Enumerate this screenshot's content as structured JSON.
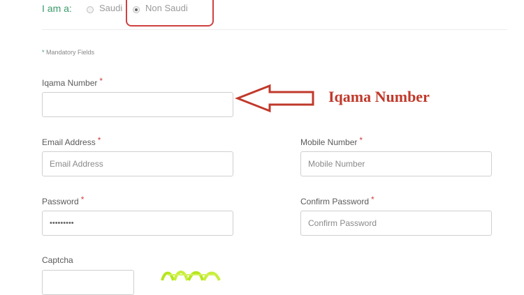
{
  "user_type": {
    "label": "I am a:",
    "options": [
      {
        "label": "Saudi",
        "selected": false
      },
      {
        "label": "Non Saudi",
        "selected": true
      }
    ]
  },
  "form": {
    "mandatory_note": "Mandatory Fields",
    "mandatory_marker": "*",
    "required_marker": "*",
    "iqama": {
      "label": "Iqama Number",
      "value": "",
      "placeholder": ""
    },
    "email": {
      "label": "Email Address",
      "value": "",
      "placeholder": "Email Address"
    },
    "mobile": {
      "label": "Mobile Number",
      "value": "",
      "placeholder": "Mobile Number"
    },
    "password": {
      "label": "Password",
      "value": "•••••••••",
      "placeholder": ""
    },
    "confirm_password": {
      "label": "Confirm Password",
      "value": "",
      "placeholder": "Confirm Password"
    },
    "captcha": {
      "label": "Captcha",
      "value": ""
    }
  },
  "annotation": {
    "text": "Iqama Number",
    "color": "#c0392b"
  },
  "colors": {
    "accent_green": "#3a9a6a",
    "required_red": "#d04040"
  }
}
